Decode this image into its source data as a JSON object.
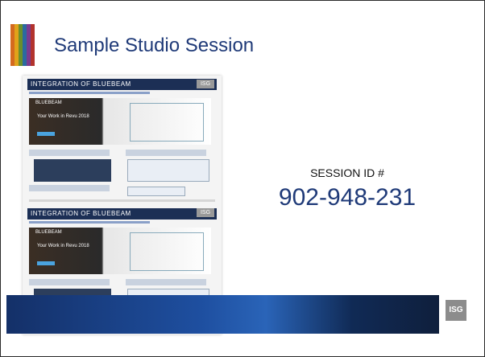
{
  "slide": {
    "title": "Sample Studio Session",
    "session_label": "SESSION ID #",
    "session_id": "902-948-231",
    "logo_text": "ISG"
  },
  "accent_colors": [
    "#d46a1f",
    "#e0a21a",
    "#6a8f2b",
    "#2b6aa0",
    "#7a3b8f",
    "#b2332d"
  ],
  "thumbnails": [
    {
      "header": "INTEGRATION OF BLUEBEAM",
      "brand": "BLUEBEAM",
      "hero_text": "Your Work in Revu 2018",
      "tag": "ISG"
    },
    {
      "header": "INTEGRATION OF BLUEBEAM",
      "brand": "BLUEBEAM",
      "hero_text": "Your Work in Revu 2018",
      "tag": "ISG"
    }
  ]
}
